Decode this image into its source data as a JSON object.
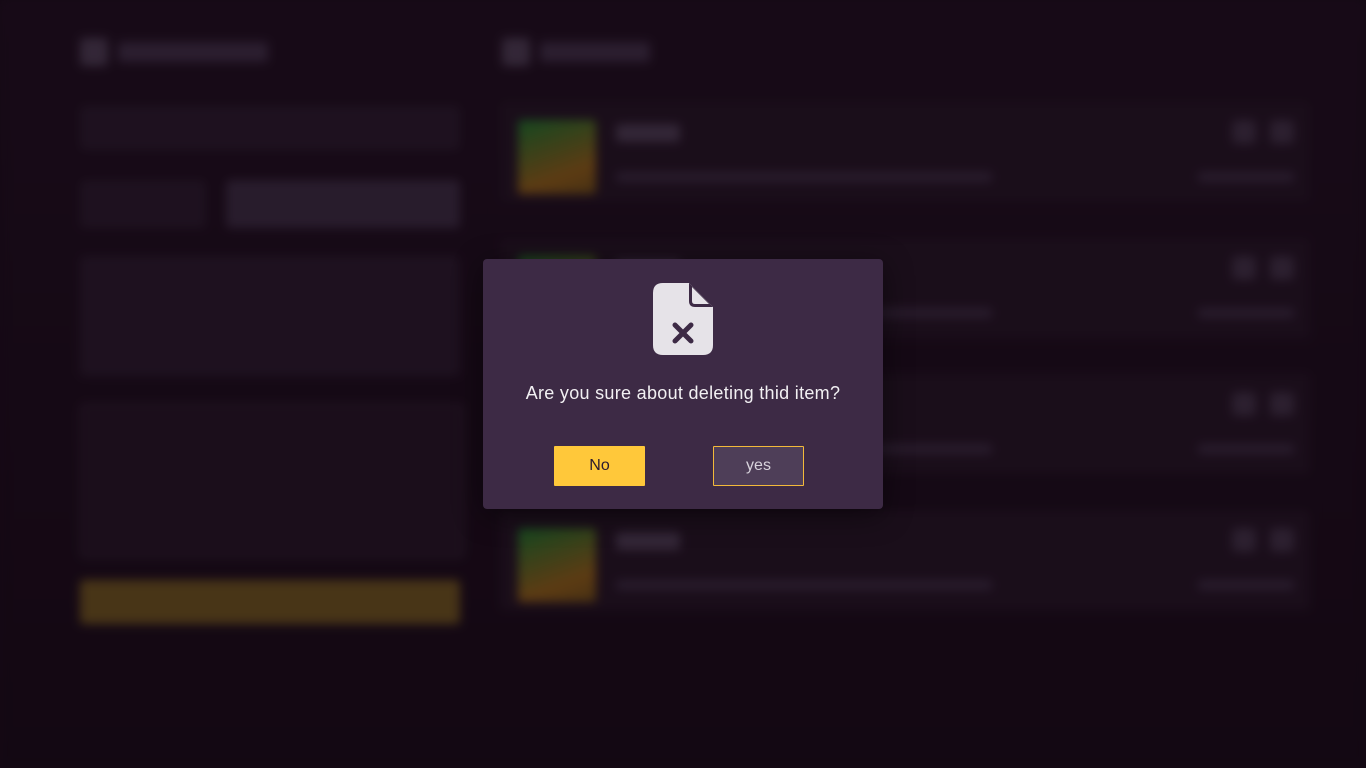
{
  "dialog": {
    "icon": "file-x-icon",
    "message": "Are you sure about deleting thid item?",
    "no_label": "No",
    "yes_label": "yes"
  },
  "colors": {
    "modal_bg": "#3d2a45",
    "accent_yellow": "#ffc83a",
    "page_bg": "#1c0d1c"
  }
}
